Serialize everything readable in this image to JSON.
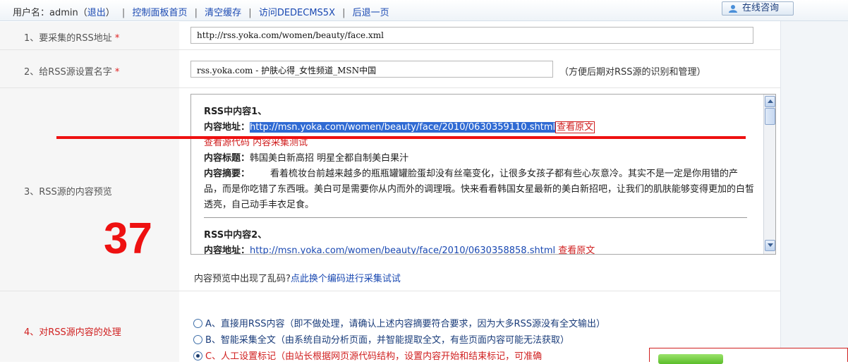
{
  "topbar": {
    "user_prefix": "用户名：admin（",
    "logout": "退出",
    "user_suffix": "）",
    "sep": "|",
    "dashboard": "控制面板首页",
    "clear_cache": "清空缓存",
    "visit": "访问DEDECMS5X",
    "back": "后退一页",
    "consult": "在线咨询"
  },
  "form": {
    "rss_url_label": "1、要采集的RSS地址",
    "rss_url_value": "http://rss.yoka.com/women/beauty/face.xml",
    "name_label": "2、给RSS源设置名字",
    "name_value": "rss.yoka.com - 护肤心得_女性频道_MSN中国",
    "name_hint": "（方便后期对RSS源的识别和管理）",
    "required_mark": "*",
    "preview_label": "3、RSS源的内容预览",
    "process_label": "4、对RSS源内容的处理"
  },
  "preview": {
    "item1_title": "RSS中内容1、",
    "url_label": "内容地址：",
    "item1_url": "http://msn.yoka.com/women/beauty/face/2010/0630359110.shtml",
    "view_original": "查看原文",
    "view_source": "查看源代码",
    "collect_test": "内容采集测试",
    "title_label": "内容标题：",
    "item1_title_value": "韩国美白新高招 明星全都自制美白果汁",
    "summary_label": "内容摘要：",
    "item1_summary": "看着梳妆台前越来越多的瓶瓶罐罐脸蛋却没有丝毫变化，让很多女孩子都有些心灰意冷。其实不是一定是你用错的产品，而是你吃错了东西哦。美白可是需要你从内而外的调理哦。快来看看韩国女星最新的美白新招吧，让我们的肌肤能够变得更加的白皙透亮，自己动手丰衣足食。",
    "item2_title": "RSS中内容2、",
    "item2_url": "http://msn.yoka.com/women/beauty/face/2010/0630358858.shtml"
  },
  "garbled": {
    "text": "内容预览中出现了乱码?",
    "link": "点此换个编码进行采集试试"
  },
  "options": [
    {
      "prefix": "A、",
      "title": "直接用RSS内容",
      "desc": "（即不做处理，请确认上述内容摘要符合要求，因为大多RSS源没有全文输出）",
      "selected": false
    },
    {
      "prefix": "B、",
      "title": "智能采集全文",
      "desc": "（由系统自动分析页面，并智能提取全文，有些页面内容可能无法获取）",
      "selected": false
    },
    {
      "prefix": "C、",
      "title": "人工设置标记",
      "desc": "（由站长根据网页源代码结构，设置内容开始和结束标记，可准确",
      "selected": true
    }
  ],
  "annotation": {
    "number": "37"
  },
  "colors": {
    "link_blue": "#1a49b2",
    "annotation_red": "#ee1111",
    "selection_blue": "#2f6ad3"
  }
}
